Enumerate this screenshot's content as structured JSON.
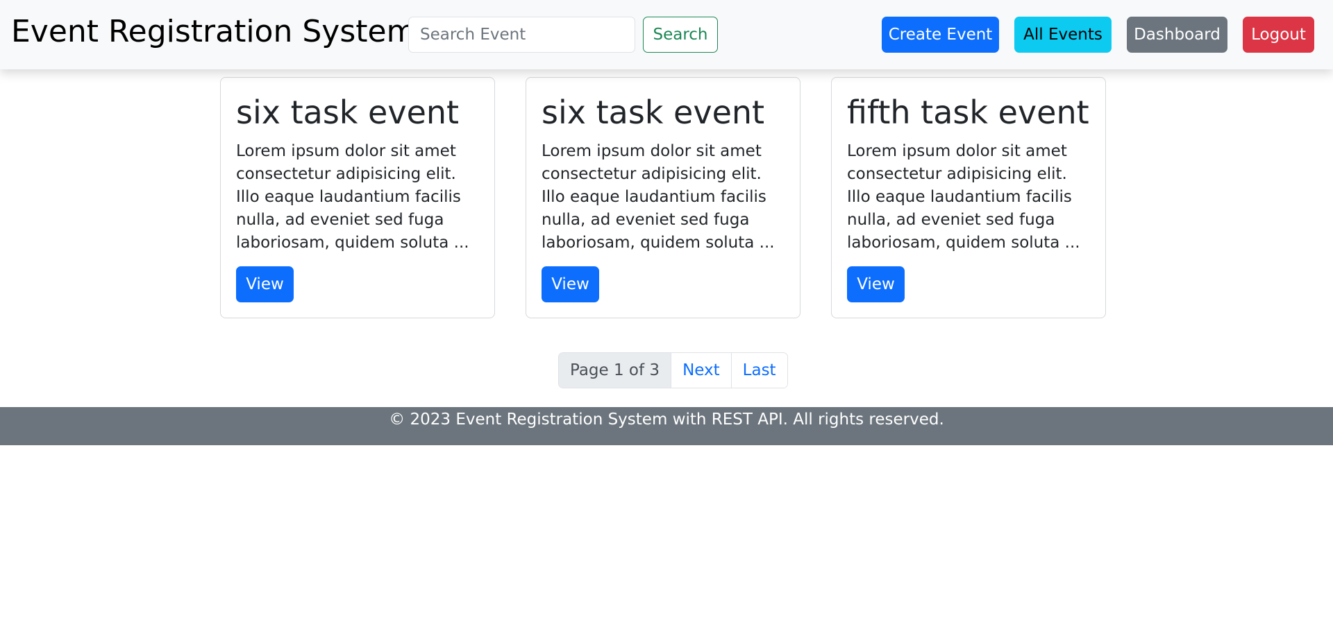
{
  "navbar": {
    "brand": "Event Registration System",
    "search_placeholder": "Search Event",
    "search_value": "",
    "search_button": "Search",
    "create_event": "Create Event",
    "all_events": "All Events",
    "dashboard": "Dashboard",
    "logout": "Logout"
  },
  "events": [
    {
      "title": "six task event",
      "description": "Lorem ipsum dolor sit amet consectetur adipisicing elit. Illo eaque laudantium facilis nulla, ad eveniet sed fuga laboriosam, quidem soluta ...",
      "button": "View"
    },
    {
      "title": "six task event",
      "description": "Lorem ipsum dolor sit amet consectetur adipisicing elit. Illo eaque laudantium facilis nulla, ad eveniet sed fuga laboriosam, quidem soluta ...",
      "button": "View"
    },
    {
      "title": "fifth task event",
      "description": "Lorem ipsum dolor sit amet consectetur adipisicing elit. Illo eaque laudantium facilis nulla, ad eveniet sed fuga laboriosam, quidem soluta ...",
      "button": "View"
    }
  ],
  "pagination": {
    "current": "Page 1 of 3",
    "next": "Next",
    "last": "Last"
  },
  "footer": {
    "text": "© 2023 Event Registration System with REST API. All rights reserved."
  },
  "colors": {
    "primary": "#0d6efd",
    "info": "#0dcaf0",
    "secondary": "#6c757d",
    "danger": "#dc3545",
    "success": "#198754"
  }
}
